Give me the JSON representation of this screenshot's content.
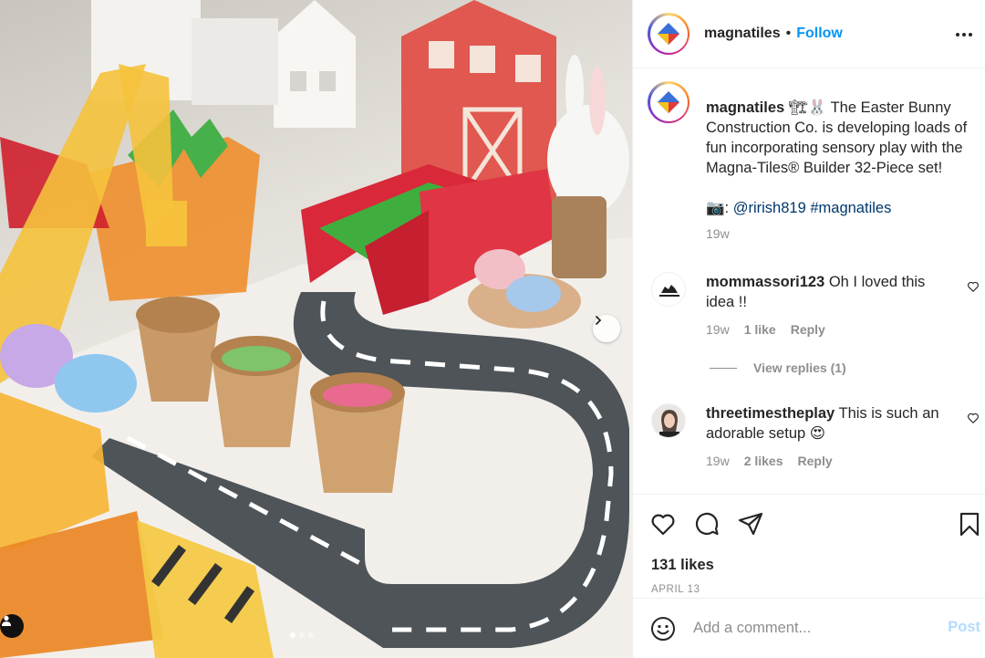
{
  "post_image": {
    "alt_icon": "user-tag-icon",
    "next_icon": "chevron-right-icon",
    "carousel_dots": 3,
    "active_dot": 1
  },
  "header": {
    "username": "magnatiles",
    "separator": "•",
    "follow_label": "Follow",
    "more_icon": "more-horizontal-icon"
  },
  "caption": {
    "username": "magnatiles",
    "emojis": "🏗🐰",
    "text_line1": " The Easter Bunny Construction Co. is developing loads of fun incorporating sensory play with the Magna-Tiles® Builder 32-Piece set!",
    "camera_emoji": "📷:",
    "mention": "@rirish819",
    "hashtag": "#magnatiles",
    "time": "19w"
  },
  "comments": [
    {
      "username": "mommassori123",
      "text": " Oh I loved this idea !!",
      "time": "19w",
      "likes": "1 like",
      "reply_label": "Reply",
      "view_replies": "View replies (1)"
    },
    {
      "username": "threetimestheplay",
      "text": " This is such an adorable setup 😍",
      "time": "19w",
      "likes": "2 likes",
      "reply_label": "Reply"
    }
  ],
  "actions": {
    "like_icon": "heart-icon",
    "comment_icon": "comment-icon",
    "share_icon": "send-icon",
    "save_icon": "bookmark-icon",
    "likes_count": "131 likes",
    "date": "APRIL 13"
  },
  "add_comment": {
    "emoji_icon": "smiley-icon",
    "placeholder": "Add a comment...",
    "post_label": "Post"
  },
  "colors": {
    "follow_blue": "#0095f6",
    "post_disabled": "#b3dbff",
    "link_dark_blue": "#00376b",
    "secondary_text": "#8e8e8e",
    "border": "#efefef"
  }
}
